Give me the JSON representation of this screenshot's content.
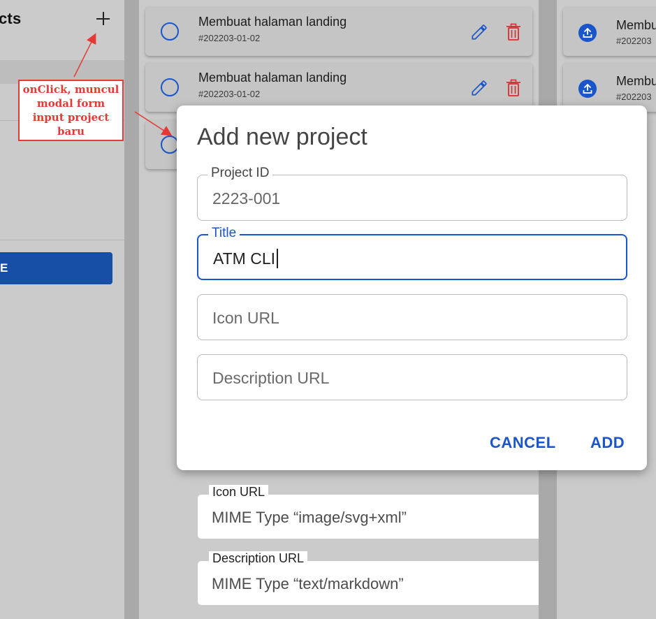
{
  "left_panel": {
    "title": "cts",
    "primary_button_label": "E"
  },
  "annotation": {
    "text": "onClick, muncul modal form input project baru",
    "color": "#e53935"
  },
  "tasks": [
    {
      "title": "Membuat halaman landing",
      "id": "#202203-01-02"
    },
    {
      "title": "Membuat halaman landing",
      "id": "#202203-01-02"
    }
  ],
  "right_cards": [
    {
      "title": "Membu",
      "id": "#202203"
    },
    {
      "title": "Membu",
      "id": "#202203"
    }
  ],
  "modal": {
    "title": "Add new project",
    "fields": {
      "project_id": {
        "label": "Project ID",
        "value": "2223-001"
      },
      "title": {
        "label": "Title",
        "value": "ATM CLI"
      },
      "icon_url": {
        "placeholder": "Icon URL"
      },
      "description_url": {
        "placeholder": "Description URL"
      }
    },
    "cancel_label": "CANCEL",
    "add_label": "ADD"
  },
  "background_form": {
    "icon_url": {
      "label": "Icon URL",
      "placeholder": "MIME Type “image/svg+xml”"
    },
    "description_url": {
      "label": "Description URL",
      "placeholder": "MIME Type “text/markdown”"
    }
  },
  "colors": {
    "accent": "#1a56c9",
    "primary_button": "#174ea6",
    "delete": "#d32f2f",
    "annotation": "#e53935"
  },
  "icons": [
    "add-icon",
    "circle-icon",
    "edit-icon",
    "delete-icon",
    "upload-icon"
  ]
}
